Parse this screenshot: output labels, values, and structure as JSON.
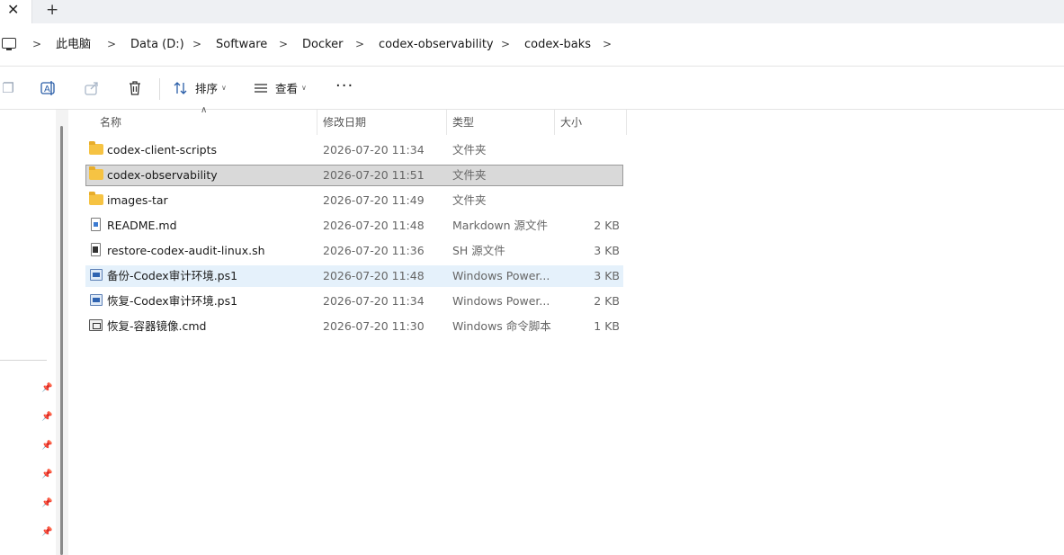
{
  "tabs": {
    "close_glyph": "✕",
    "new_tab_glyph": "+"
  },
  "breadcrumb": {
    "items": [
      "此电脑",
      "Data (D:)",
      "Software",
      "Docker",
      "codex-observability",
      "codex-baks"
    ],
    "separator": ">"
  },
  "toolbar": {
    "sort_label": "排序",
    "view_label": "查看",
    "more_label": "···",
    "icons": [
      "copy-icon",
      "rename-icon",
      "share-icon",
      "delete-icon",
      "sort-icon",
      "view-icon"
    ]
  },
  "columns": {
    "name": "名称",
    "date": "修改日期",
    "type": "类型",
    "size": "大小"
  },
  "files": [
    {
      "name": "codex-client-scripts",
      "date": "2026-07-20 11:34",
      "type": "文件夹",
      "size": "",
      "icon": "folder-icon",
      "state": "normal"
    },
    {
      "name": "codex-observability",
      "date": "2026-07-20 11:51",
      "type": "文件夹",
      "size": "",
      "icon": "folder-icon",
      "state": "selected"
    },
    {
      "name": "images-tar",
      "date": "2026-07-20 11:49",
      "type": "文件夹",
      "size": "",
      "icon": "folder-icon",
      "state": "normal"
    },
    {
      "name": "README.md",
      "date": "2026-07-20 11:48",
      "type": "Markdown 源文件",
      "size": "2 KB",
      "icon": "markdown-file-icon",
      "state": "normal"
    },
    {
      "name": "restore-codex-audit-linux.sh",
      "date": "2026-07-20 11:36",
      "type": "SH 源文件",
      "size": "3 KB",
      "icon": "shell-file-icon",
      "state": "normal"
    },
    {
      "name": "备份-Codex审计环境.ps1",
      "date": "2026-07-20 11:48",
      "type": "Windows Power...",
      "size": "3 KB",
      "icon": "powershell-file-icon",
      "state": "hover"
    },
    {
      "name": "恢复-Codex审计环境.ps1",
      "date": "2026-07-20 11:34",
      "type": "Windows Power...",
      "size": "2 KB",
      "icon": "powershell-file-icon",
      "state": "normal"
    },
    {
      "name": "恢复-容器镜像.cmd",
      "date": "2026-07-20 11:30",
      "type": "Windows 命令脚本",
      "size": "1 KB",
      "icon": "cmd-file-icon",
      "state": "normal"
    }
  ],
  "colors": {
    "selected_bg": "#d9d9d9",
    "hover_bg": "#e5f1fb",
    "folder": "#f6c343",
    "accent": "#2a5ea8"
  }
}
